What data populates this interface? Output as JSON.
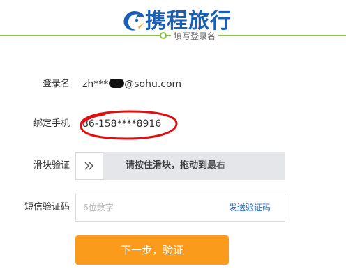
{
  "header": {
    "brand_name": "携程旅行",
    "step_label": "填写登录名"
  },
  "form": {
    "login_name_label": "登录名",
    "login_name_value_prefix": "zh***",
    "login_name_value_suffix": "@sohu.com",
    "phone_label": "绑定手机",
    "phone_value": "86-158****8916",
    "slider_label": "滑块验证",
    "slider_hint": "请按住滑块，拖动到最右",
    "sms_label": "短信验证码",
    "sms_placeholder": "6位数字",
    "send_code_label": "发送验证码",
    "submit_label": "下一步，验证"
  },
  "colors": {
    "brand_blue": "#1a5fb4",
    "progress_green": "#8bc34a",
    "annotation_red": "#e01010",
    "submit_orange": "#fb9b1c",
    "link_blue": "#2c6fc6"
  },
  "icons": {
    "logo": "dolphin-logo-icon",
    "slider_handle": "double-chevron-right-icon"
  }
}
